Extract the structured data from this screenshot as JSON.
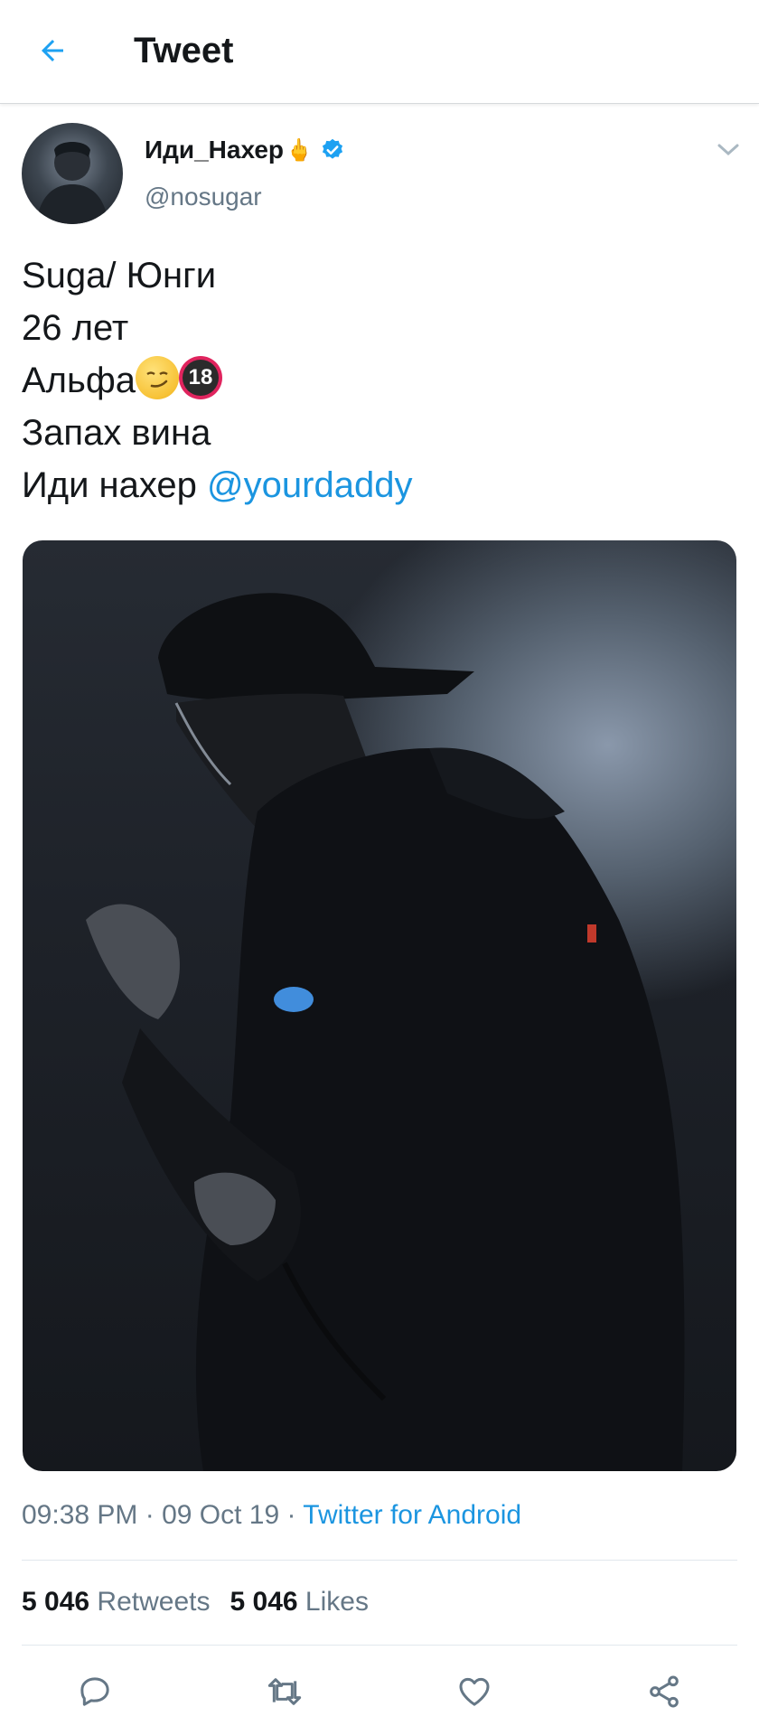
{
  "header": {
    "title": "Tweet"
  },
  "tweet": {
    "display_name": "Иди_Нахер",
    "name_emoji": "🖕",
    "handle": "@nosugar",
    "lines": [
      "Suga/ Юнги",
      "26 лет",
      "Альфа",
      "Запах вина",
      "Иди нахер "
    ],
    "badge_text": "18",
    "mention": "@yourdaddy",
    "time": "09:38 PM",
    "sep": " · ",
    "date": "09 Oct 19",
    "source": "Twitter for Android",
    "retweets_count": "5 046",
    "retweets_label": "Retweets",
    "likes_count": "5 046",
    "likes_label": "Likes"
  },
  "colors": {
    "accent": "#1b95e0",
    "verified": "#1da1f2",
    "secondary_text": "#657786",
    "primary_text": "#14171a"
  },
  "icons": {
    "back": "back-arrow-icon",
    "verified": "verified-badge-icon",
    "menu": "chevron-down-icon",
    "reply": "reply-icon",
    "retweet": "retweet-icon",
    "like": "heart-icon",
    "share": "share-icon"
  }
}
